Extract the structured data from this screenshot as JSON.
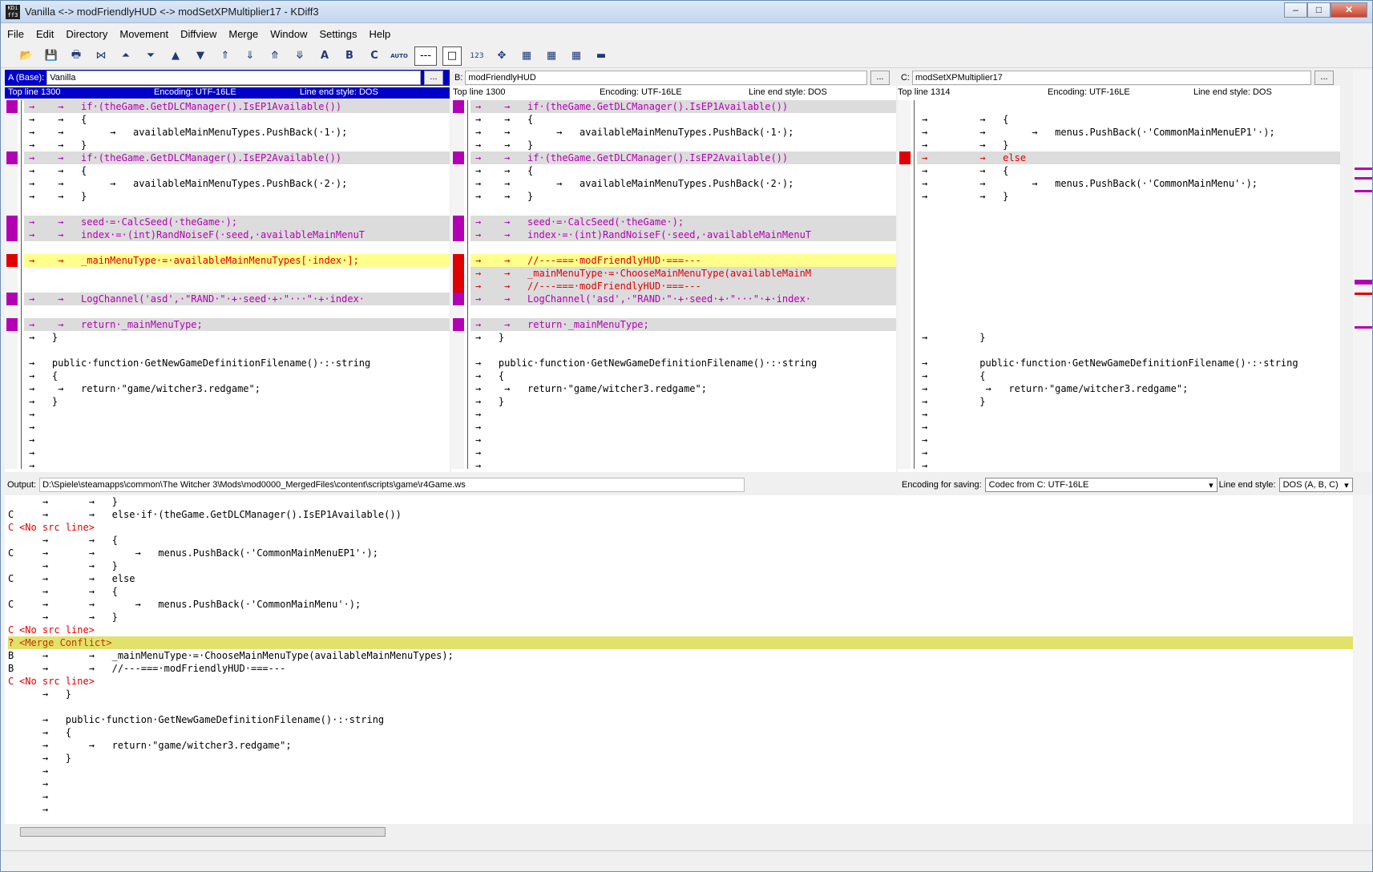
{
  "window": {
    "title": "Vanilla <-> modFriendlyHUD <-> modSetXPMultiplier17 - KDiff3"
  },
  "menu": [
    "File",
    "Edit",
    "Directory",
    "Movement",
    "Diffview",
    "Merge",
    "Window",
    "Settings",
    "Help"
  ],
  "toolbar": {
    "num_label": "123",
    "a_label": "A",
    "b_label": "B",
    "c_label": "C",
    "auto_label": "AUTO",
    "dash_label": "---"
  },
  "panes": [
    {
      "id": "A",
      "label": "A (Base):",
      "file": "Vanilla",
      "topline": "Top line 1300",
      "encoding": "Encoding: UTF-16LE",
      "lineend": "Line end style: DOS",
      "browse": "..."
    },
    {
      "id": "B",
      "label": "B:",
      "file": "modFriendlyHUD",
      "topline": "Top line 1300",
      "encoding": "Encoding: UTF-16LE",
      "lineend": "Line end style: DOS",
      "browse": "..."
    },
    {
      "id": "C",
      "label": "C:",
      "file": "modSetXPMultiplier17",
      "topline": "Top line 1314",
      "encoding": "Encoding: UTF-16LE",
      "lineend": "Line end style: DOS",
      "browse": "..."
    }
  ],
  "lines_a": [
    {
      "t": "→    →   if·(theGame.GetDLCManager().IsEP1Available())",
      "s": "g purple"
    },
    {
      "t": "→    →   {",
      "s": "dark"
    },
    {
      "t": "→    →        →   availableMainMenuTypes.PushBack(·1·);",
      "s": "dark"
    },
    {
      "t": "→    →   }",
      "s": "dark"
    },
    {
      "t": "→    →   if·(theGame.GetDLCManager().IsEP2Available())",
      "s": "g purple"
    },
    {
      "t": "→    →   {",
      "s": "dark"
    },
    {
      "t": "→    →        →   availableMainMenuTypes.PushBack(·2·);",
      "s": "dark"
    },
    {
      "t": "→    →   }",
      "s": "dark"
    },
    {
      "t": "",
      "s": ""
    },
    {
      "t": "→    →   seed·=·CalcSeed(·theGame·);",
      "s": "g purple"
    },
    {
      "t": "→    →   index·=·(int)RandNoiseF(·seed,·availableMainMenuT",
      "s": "g purple"
    },
    {
      "t": "",
      "s": ""
    },
    {
      "t": "→    →   _mainMenuType·=·availableMainMenuTypes[·index·];",
      "s": "y red"
    },
    {
      "t": "",
      "s": ""
    },
    {
      "t": "",
      "s": ""
    },
    {
      "t": "→    →   LogChannel('asd',·\"RAND·\"·+·seed·+·\"···\"·+·index·",
      "s": "g purple"
    },
    {
      "t": "",
      "s": ""
    },
    {
      "t": "→    →   return·_mainMenuType;",
      "s": "g purple"
    },
    {
      "t": "→   }",
      "s": "dark"
    },
    {
      "t": "",
      "s": ""
    },
    {
      "t": "→   public·function·GetNewGameDefinitionFilename()·:·string",
      "s": "dark"
    },
    {
      "t": "→   {",
      "s": "dark"
    },
    {
      "t": "→    →   return·\"game/witcher3.redgame\";",
      "s": "dark"
    },
    {
      "t": "→   }",
      "s": "dark"
    },
    {
      "t": "→",
      "s": "dark"
    },
    {
      "t": "→",
      "s": "dark"
    },
    {
      "t": "→",
      "s": "dark"
    },
    {
      "t": "→",
      "s": "dark"
    },
    {
      "t": "→",
      "s": "dark"
    }
  ],
  "lines_b": [
    {
      "t": "→    →   if·(theGame.GetDLCManager().IsEP1Available())",
      "s": "g purple"
    },
    {
      "t": "→    →   {",
      "s": "dark"
    },
    {
      "t": "→    →        →   availableMainMenuTypes.PushBack(·1·);",
      "s": "dark"
    },
    {
      "t": "→    →   }",
      "s": "dark"
    },
    {
      "t": "→    →   if·(theGame.GetDLCManager().IsEP2Available())",
      "s": "g purple"
    },
    {
      "t": "→    →   {",
      "s": "dark"
    },
    {
      "t": "→    →        →   availableMainMenuTypes.PushBack(·2·);",
      "s": "dark"
    },
    {
      "t": "→    →   }",
      "s": "dark"
    },
    {
      "t": "",
      "s": ""
    },
    {
      "t": "→    →   seed·=·CalcSeed(·theGame·);",
      "s": "g purple"
    },
    {
      "t": "→    →   index·=·(int)RandNoiseF(·seed,·availableMainMenuT",
      "s": "g purple"
    },
    {
      "t": "",
      "s": ""
    },
    {
      "t": "→    →   //---===·modFriendlyHUD·===---",
      "s": "y red"
    },
    {
      "t": "→    →   _mainMenuType·=·ChooseMainMenuType(availableMainM",
      "s": "g red"
    },
    {
      "t": "→    →   //---===·modFriendlyHUD·===---",
      "s": "g red"
    },
    {
      "t": "→    →   LogChannel('asd',·\"RAND·\"·+·seed·+·\"···\"·+·index·",
      "s": "g purple"
    },
    {
      "t": "",
      "s": ""
    },
    {
      "t": "→    →   return·_mainMenuType;",
      "s": "g purple"
    },
    {
      "t": "→   }",
      "s": "dark"
    },
    {
      "t": "",
      "s": ""
    },
    {
      "t": "→   public·function·GetNewGameDefinitionFilename()·:·string",
      "s": "dark"
    },
    {
      "t": "→   {",
      "s": "dark"
    },
    {
      "t": "→    →   return·\"game/witcher3.redgame\";",
      "s": "dark"
    },
    {
      "t": "→   }",
      "s": "dark"
    },
    {
      "t": "→",
      "s": "dark"
    },
    {
      "t": "→",
      "s": "dark"
    },
    {
      "t": "→",
      "s": "dark"
    },
    {
      "t": "→",
      "s": "dark"
    },
    {
      "t": "→",
      "s": "dark"
    }
  ],
  "lines_c": [
    {
      "t": "",
      "s": ""
    },
    {
      "t": "→         →   {",
      "s": "dark"
    },
    {
      "t": "→         →        →   menus.PushBack(·'CommonMainMenuEP1'·);",
      "s": "dark"
    },
    {
      "t": "→         →   }",
      "s": "dark"
    },
    {
      "t": "→         →   else",
      "s": "g red"
    },
    {
      "t": "→         →   {",
      "s": "dark"
    },
    {
      "t": "→         →        →   menus.PushBack(·'CommonMainMenu'·);",
      "s": "dark"
    },
    {
      "t": "→         →   }",
      "s": "dark"
    },
    {
      "t": "",
      "s": ""
    },
    {
      "t": "",
      "s": ""
    },
    {
      "t": "",
      "s": ""
    },
    {
      "t": "",
      "s": ""
    },
    {
      "t": "",
      "s": ""
    },
    {
      "t": "",
      "s": ""
    },
    {
      "t": "",
      "s": ""
    },
    {
      "t": "",
      "s": ""
    },
    {
      "t": "",
      "s": ""
    },
    {
      "t": "",
      "s": ""
    },
    {
      "t": "→         }",
      "s": "dark"
    },
    {
      "t": "",
      "s": ""
    },
    {
      "t": "→         public·function·GetNewGameDefinitionFilename()·:·string",
      "s": "dark"
    },
    {
      "t": "→         {",
      "s": "dark"
    },
    {
      "t": "→          →   return·\"game/witcher3.redgame\";",
      "s": "dark"
    },
    {
      "t": "→         }",
      "s": "dark"
    },
    {
      "t": "→",
      "s": "dark"
    },
    {
      "t": "→",
      "s": "dark"
    },
    {
      "t": "→",
      "s": "dark"
    },
    {
      "t": "→",
      "s": "dark"
    },
    {
      "t": "→",
      "s": "dark"
    }
  ],
  "output": {
    "label": "Output:",
    "path": "D:\\Spiele\\steamapps\\common\\The Witcher 3\\Mods\\mod0000_MergedFiles\\content\\scripts\\game\\r4Game.ws",
    "enc_label": "Encoding for saving:",
    "enc_value": "Codec from C: UTF-16LE",
    "lineend_label": "Line end style:",
    "lineend_value": "DOS (A, B, C)"
  },
  "merge_lines": [
    {
      "src": "",
      "t": "    →       →   }",
      "k": ""
    },
    {
      "src": "C",
      "t": "    →       →   else·if·(theGame.GetDLCManager().IsEP1Available())",
      "k": ""
    },
    {
      "src": "C",
      "t": "<No src line>",
      "k": "nosrc"
    },
    {
      "src": "",
      "t": "    →       →   {",
      "k": ""
    },
    {
      "src": "C",
      "t": "    →       →       →   menus.PushBack(·'CommonMainMenuEP1'·);",
      "k": ""
    },
    {
      "src": "",
      "t": "    →       →   }",
      "k": ""
    },
    {
      "src": "C",
      "t": "    →       →   else",
      "k": ""
    },
    {
      "src": "",
      "t": "    →       →   {",
      "k": ""
    },
    {
      "src": "C",
      "t": "    →       →       →   menus.PushBack(·'CommonMainMenu'·);",
      "k": ""
    },
    {
      "src": "",
      "t": "    →       →   }",
      "k": ""
    },
    {
      "src": "C",
      "t": "<No src line>",
      "k": "nosrc"
    },
    {
      "src": "?",
      "t": "<Merge Conflict>",
      "k": "conf"
    },
    {
      "src": "B",
      "t": "    →       →   _mainMenuType·=·ChooseMainMenuType(availableMainMenuTypes);",
      "k": ""
    },
    {
      "src": "B",
      "t": "    →       →   //---===·modFriendlyHUD·===---",
      "k": ""
    },
    {
      "src": "C",
      "t": "<No src line>",
      "k": "nosrc"
    },
    {
      "src": "",
      "t": "    →   }",
      "k": ""
    },
    {
      "src": "",
      "t": "",
      "k": ""
    },
    {
      "src": "",
      "t": "    →   public·function·GetNewGameDefinitionFilename()·:·string",
      "k": ""
    },
    {
      "src": "",
      "t": "    →   {",
      "k": ""
    },
    {
      "src": "",
      "t": "    →       →   return·\"game/witcher3.redgame\";",
      "k": ""
    },
    {
      "src": "",
      "t": "    →   }",
      "k": ""
    },
    {
      "src": "",
      "t": "    →",
      "k": ""
    },
    {
      "src": "",
      "t": "    →",
      "k": ""
    },
    {
      "src": "",
      "t": "    →",
      "k": ""
    },
    {
      "src": "",
      "t": "    →",
      "k": ""
    }
  ],
  "colors": {
    "purple": "#b400b4",
    "red": "#e00000",
    "green": "#00a000",
    "active_header": "#0000c8",
    "conflict": "#e2e26a"
  }
}
